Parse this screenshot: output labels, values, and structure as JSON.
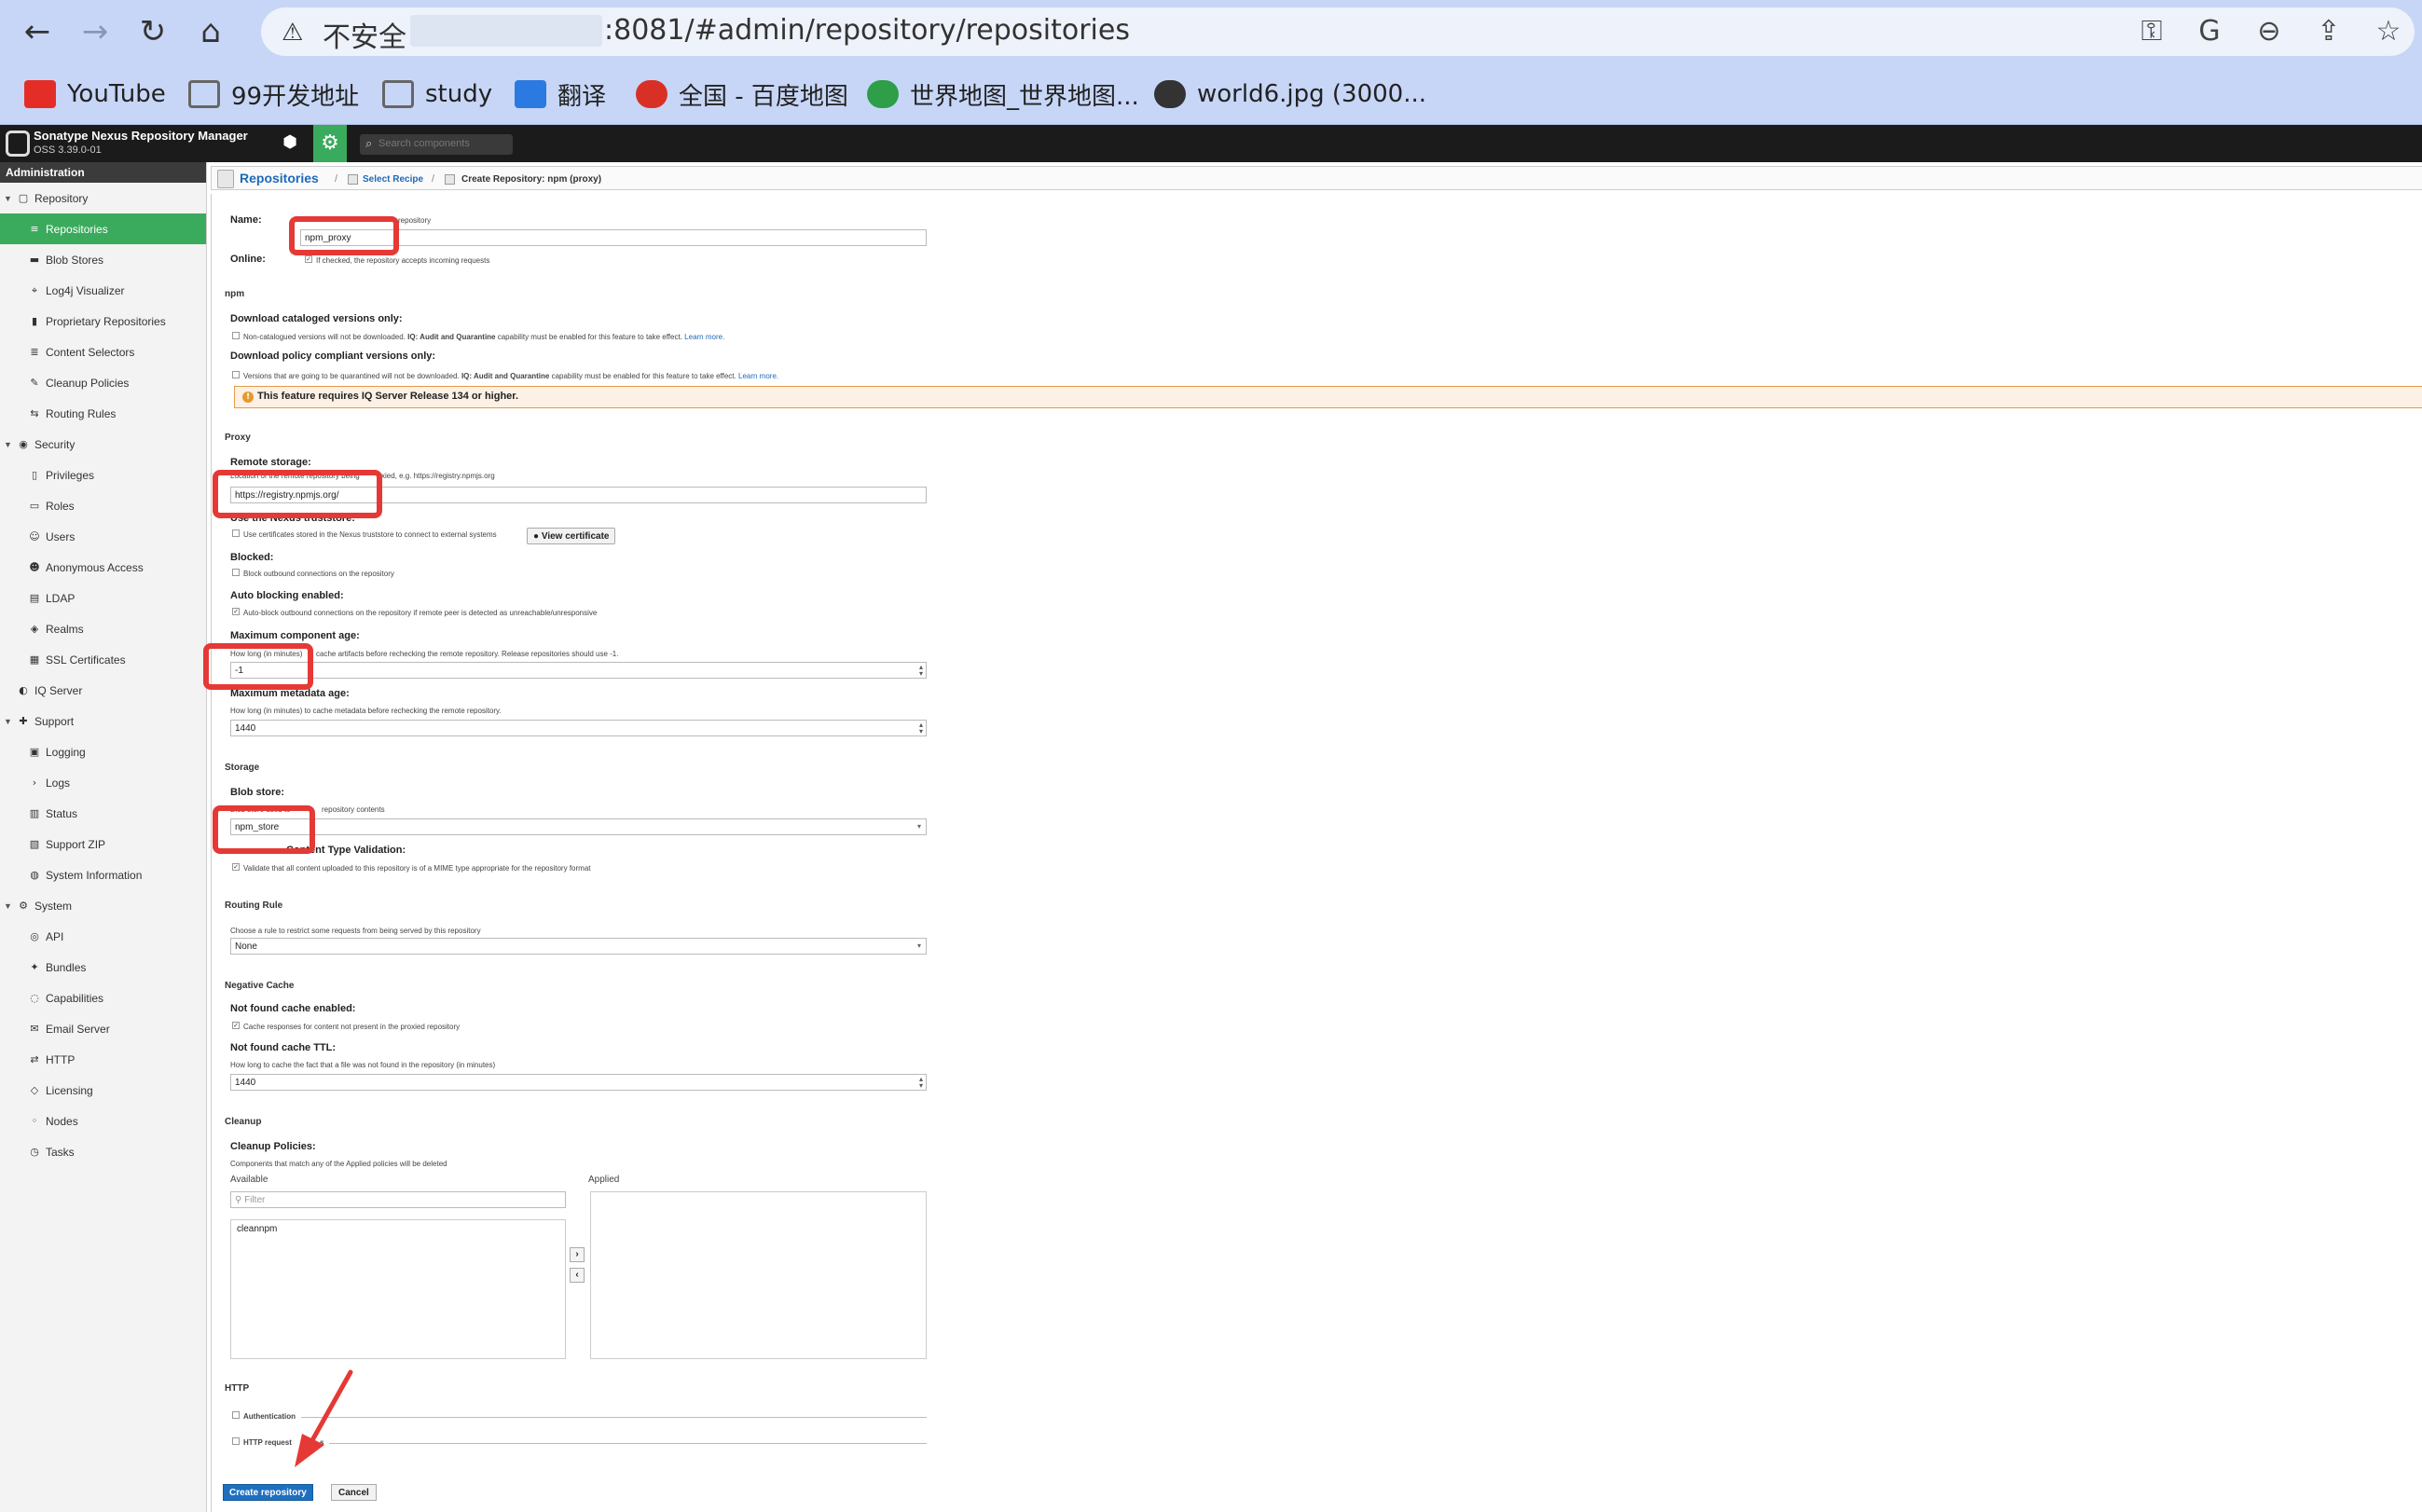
{
  "browser": {
    "url_warning": "不安全",
    "url": ":8081/#admin/repository/repositories",
    "bookmarks": [
      {
        "label": "YouTube",
        "color": "#e52d27"
      },
      {
        "label": "99开发地址",
        "color": "#777777"
      },
      {
        "label": "study",
        "color": "#777777"
      },
      {
        "label": "翻译",
        "color": "#2a7ae2"
      },
      {
        "label": "全国 - 百度地图",
        "color": "#d93025"
      },
      {
        "label": "世界地图_世界地图...",
        "color": "#2e9e48"
      },
      {
        "label": "world6.jpg (3000...",
        "color": "#333333"
      }
    ]
  },
  "header": {
    "app_name": "Sonatype Nexus Repository Manager",
    "version": "OSS 3.39.0-01",
    "search_placeholder": "Search components"
  },
  "sidebar": {
    "title": "Administration",
    "items": [
      {
        "label": "Repository",
        "level": 0,
        "caret": true
      },
      {
        "label": "Repositories",
        "level": 1,
        "active": true
      },
      {
        "label": "Blob Stores",
        "level": 1
      },
      {
        "label": "Log4j Visualizer",
        "level": 1
      },
      {
        "label": "Proprietary Repositories",
        "level": 1
      },
      {
        "label": "Content Selectors",
        "level": 1
      },
      {
        "label": "Cleanup Policies",
        "level": 1
      },
      {
        "label": "Routing Rules",
        "level": 1
      },
      {
        "label": "Security",
        "level": 0,
        "caret": true
      },
      {
        "label": "Privileges",
        "level": 1
      },
      {
        "label": "Roles",
        "level": 1
      },
      {
        "label": "Users",
        "level": 1
      },
      {
        "label": "Anonymous Access",
        "level": 1
      },
      {
        "label": "LDAP",
        "level": 1
      },
      {
        "label": "Realms",
        "level": 1
      },
      {
        "label": "SSL Certificates",
        "level": 1
      },
      {
        "label": "IQ Server",
        "level": 0
      },
      {
        "label": "Support",
        "level": 0,
        "caret": true
      },
      {
        "label": "Logging",
        "level": 1
      },
      {
        "label": "Logs",
        "level": 1
      },
      {
        "label": "Status",
        "level": 1
      },
      {
        "label": "Support ZIP",
        "level": 1
      },
      {
        "label": "System Information",
        "level": 1
      },
      {
        "label": "System",
        "level": 0,
        "caret": true
      },
      {
        "label": "API",
        "level": 1
      },
      {
        "label": "Bundles",
        "level": 1
      },
      {
        "label": "Capabilities",
        "level": 1
      },
      {
        "label": "Email Server",
        "level": 1
      },
      {
        "label": "HTTP",
        "level": 1
      },
      {
        "label": "Licensing",
        "level": 1
      },
      {
        "label": "Nodes",
        "level": 1
      },
      {
        "label": "Tasks",
        "level": 1
      }
    ]
  },
  "breadcrumb": {
    "root": "Repositories",
    "step": "Select Recipe",
    "current": "Create Repository: npm (proxy)"
  },
  "form": {
    "name_label": "Name:",
    "name_hint": "repository",
    "name_value": "npm_proxy",
    "online_label": "Online:",
    "online_hint": "If checked, the repository accepts incoming requests",
    "npm_section": "npm",
    "download_catalog_label": "Download cataloged versions only:",
    "download_catalog_hint": "Non-catalogued versions will not be downloaded.",
    "iq_audit": "IQ: Audit and Quarantine",
    "download_catalog_hint_end": "capability must be enabled for this feature to take effect.",
    "learn_more": "Learn more.",
    "download_policy_label": "Download policy compliant versions only:",
    "download_policy_hint": "Versions that are going to be quarantined will not be downloaded.",
    "warning": "This feature requires IQ Server Release 134 or higher.",
    "proxy_section": "Proxy",
    "remote_label": "Remote storage:",
    "remote_hint_a": "Location of the remote repository being",
    "remote_hint_b": "xied, e.g. https://registry.npmjs.org",
    "remote_value": "https://registry.npmjs.org/",
    "truststore_label": "Use the Nexus truststore:",
    "truststore_hint": "Use certificates stored in the Nexus truststore to connect to external systems",
    "view_cert": "View certificate",
    "blocked_label": "Blocked:",
    "blocked_hint": "Block outbound connections on the repository",
    "auto_block_label": "Auto blocking enabled:",
    "auto_block_hint": "Auto-block outbound connections on the repository if remote peer is detected as unreachable/unresponsive",
    "max_comp_label": "Maximum component age:",
    "max_comp_hint_a": "How long (in minutes)",
    "max_comp_hint_b": "cache artifacts before rechecking the remote repository. Release repositories should use -1.",
    "max_comp_value": "-1",
    "max_meta_label": "Maximum metadata age:",
    "max_meta_hint": "How long (in minutes) to cache metadata before rechecking the remote repository.",
    "max_meta_value": "1440",
    "storage_section": "Storage",
    "blob_label": "Blob store:",
    "blob_hint_a": "Blob store used to",
    "blob_hint_b": "repository contents",
    "blob_value": "npm_store",
    "strict_label": "Strict Content Type Validation:",
    "strict_label_visible": "Content Type Validation:",
    "strict_hint": "Validate that all content uploaded to this repository is of a MIME type appropriate for the repository format",
    "routing_section": "Routing Rule",
    "routing_hint": "Choose a rule to restrict some requests from being served by this repository",
    "routing_value": "None",
    "neg_cache_section": "Negative Cache",
    "nf_enabled_label": "Not found cache enabled:",
    "nf_enabled_hint": "Cache responses for content not present in the proxied repository",
    "nf_ttl_label": "Not found cache TTL:",
    "nf_ttl_hint": "How long to cache the fact that a file was not found in the repository (in minutes)",
    "nf_ttl_value": "1440",
    "cleanup_section": "Cleanup",
    "cleanup_label": "Cleanup Policies:",
    "cleanup_hint": "Components that match any of the Applied policies will be deleted",
    "available_label": "Available",
    "applied_label": "Applied",
    "filter_placeholder": "Filter",
    "available_items": [
      "cleannpm"
    ],
    "http_section": "HTTP",
    "auth_label": "Authentication",
    "http_req_label": "HTTP request",
    "http_req_label_end": "s",
    "create_button": "Create repository",
    "cancel_button": "Cancel"
  },
  "colors": {
    "accent_green": "#3aaa5c",
    "link_blue": "#1e6ab8",
    "annotation_red": "#e53935"
  }
}
